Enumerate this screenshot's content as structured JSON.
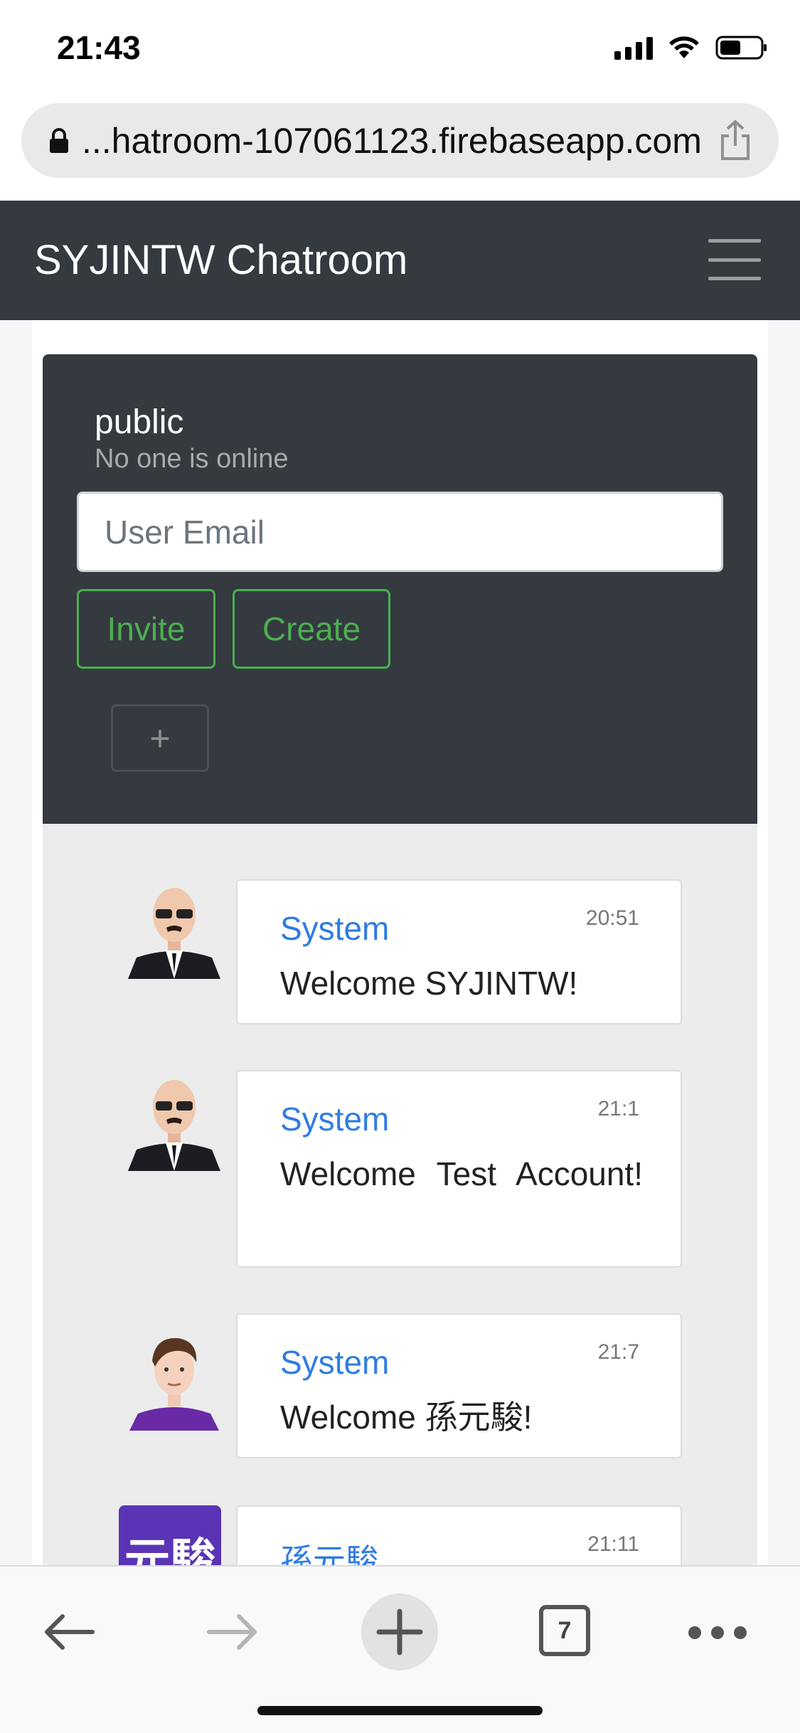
{
  "status_bar": {
    "time": "21:43"
  },
  "browser": {
    "url": "...hatroom-107061123.firebaseapp.com"
  },
  "navbar": {
    "brand": "SYJINTW Chatroom"
  },
  "room": {
    "name": "public",
    "status": "No one is online",
    "email_placeholder": "User Email",
    "invite_label": "Invite",
    "create_label": "Create",
    "add_label": "+"
  },
  "messages": [
    {
      "author": "System",
      "time": "20:51",
      "text": "Welcome SYJINTW!"
    },
    {
      "author": "System",
      "time": "21:1",
      "text": "Welcome Test Account!"
    },
    {
      "author": "System",
      "time": "21:7",
      "text": "Welcome 孫元駿!"
    },
    {
      "author": "孫元駿",
      "time": "21:11",
      "avatar_text": "元駿"
    }
  ],
  "toolbar": {
    "tab_count": "7"
  },
  "colors": {
    "navbar": "#343a40",
    "accent_green": "#4caf50",
    "author_blue": "#2f7de1",
    "cjk_avatar": "#5a34b5"
  }
}
